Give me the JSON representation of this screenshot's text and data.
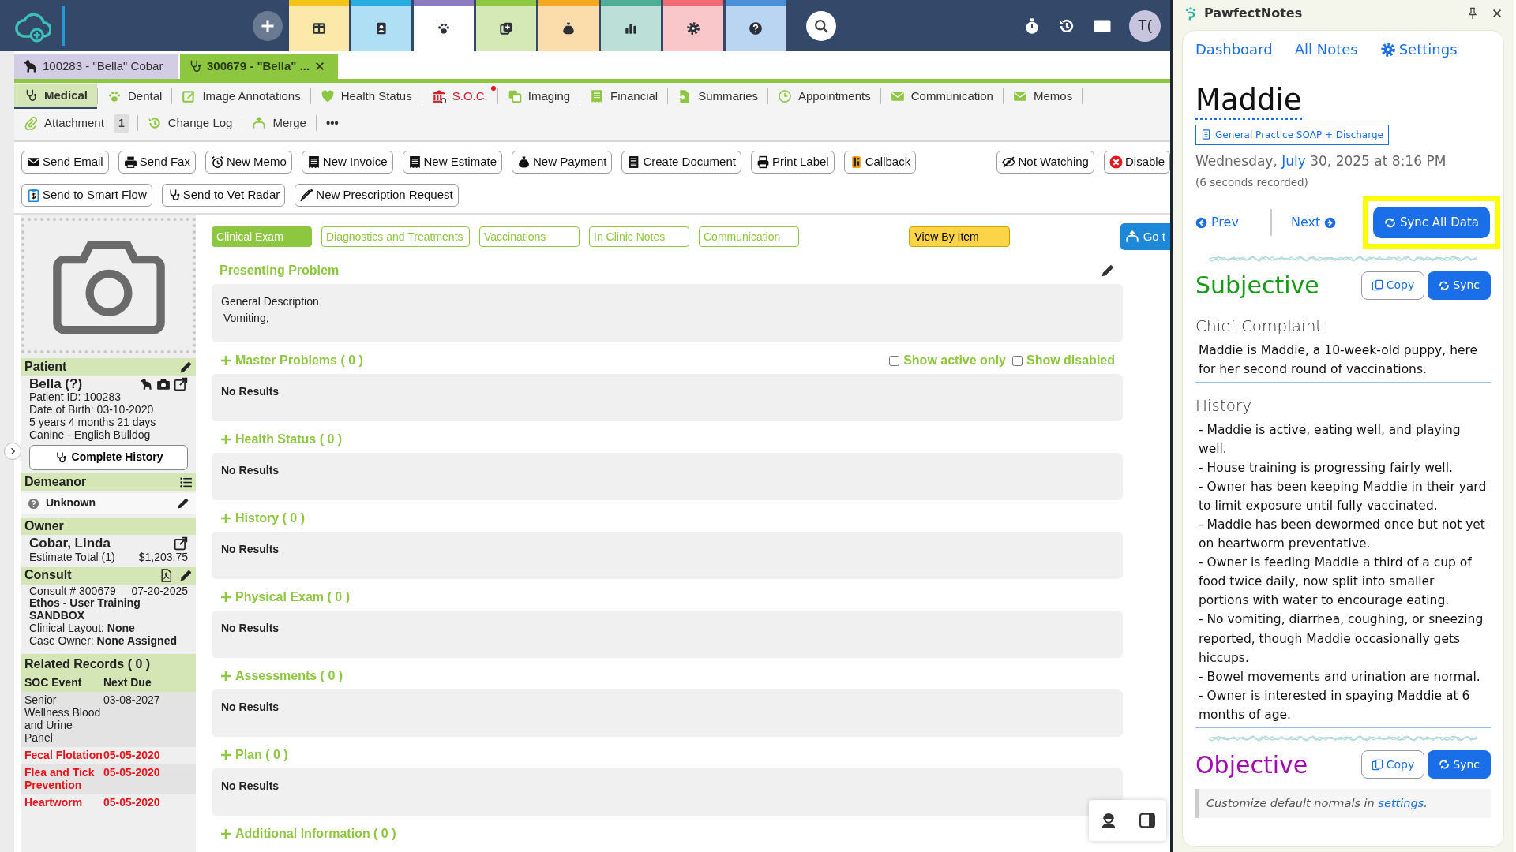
{
  "top_bar": {
    "modules": [
      {
        "color": "#f6c31c",
        "selected": false
      },
      {
        "color": "#29abe2",
        "selected": false
      },
      {
        "color": "#8e7cc3",
        "selected": true
      },
      {
        "color": "#8dc63f",
        "selected": false
      },
      {
        "color": "#f5a623",
        "selected": false
      },
      {
        "color": "#4fae96",
        "selected": false
      },
      {
        "color": "#ef6b73",
        "selected": false
      },
      {
        "color": "#4a90d9",
        "selected": false
      }
    ],
    "avatar": "T("
  },
  "record_tabs": [
    {
      "label": "100283 - \"Bella\" Cobar",
      "selected": false
    },
    {
      "label": "300679 - \"Bella\" ...",
      "selected": true
    }
  ],
  "nav_tabs": [
    {
      "label": "Medical",
      "selected": true,
      "alert": false
    },
    {
      "label": "Dental",
      "selected": false,
      "alert": false
    },
    {
      "label": "Image Annotations",
      "selected": false,
      "alert": false
    },
    {
      "label": "Health Status",
      "selected": false,
      "alert": false
    },
    {
      "label": "S.O.C.",
      "selected": false,
      "alert": true
    },
    {
      "label": "Imaging",
      "selected": false,
      "alert": false
    },
    {
      "label": "Financial",
      "selected": false,
      "alert": false
    },
    {
      "label": "Summaries",
      "selected": false,
      "alert": false
    },
    {
      "label": "Appointments",
      "selected": false,
      "alert": false
    },
    {
      "label": "Communication",
      "selected": false,
      "alert": false
    },
    {
      "label": "Memos",
      "selected": false,
      "alert": false
    }
  ],
  "nav_tools": [
    {
      "label": "Attachment",
      "count": "1"
    },
    {
      "label": "Change Log"
    },
    {
      "label": "Merge"
    }
  ],
  "more": "•••",
  "actions": [
    "Send Email",
    "Send Fax",
    "New Memo",
    "New Invoice",
    "New Estimate",
    "New Payment",
    "Create Document",
    "Print Label",
    "Callback"
  ],
  "actions_right": [
    "Not Watching",
    "Disable"
  ],
  "actions_row2": [
    "Send to Smart Flow",
    "Send to Vet Radar",
    "New Prescription Request"
  ],
  "sidebar": {
    "patient": {
      "title": "Patient",
      "name": "Bella (?)",
      "lines": [
        "Patient ID: 100283",
        "Date of Birth: 03-10-2020",
        "5 years 4 months 21 days",
        "Canine - English Bulldog"
      ],
      "button": "Complete History"
    },
    "demeanor": {
      "title": "Demeanor",
      "value": "Unknown"
    },
    "owner": {
      "title": "Owner",
      "name": "Cobar, Linda",
      "estimate_label": "Estimate Total (1)",
      "estimate_value": "$1,203.75"
    },
    "consult": {
      "title": "Consult",
      "number": "Consult # 300679",
      "date": "07-20-2025",
      "location": "Ethos - User Training SANDBOX",
      "fields": [
        "Clinical Layout: **None**",
        "Case Owner: **None Assigned**"
      ]
    },
    "related": {
      "title": "Related Records ( 0 )",
      "columns": [
        "SOC Event",
        "Next Due"
      ],
      "rows": [
        {
          "event": "Senior Wellness Blood and Urine Panel",
          "due": "03-08-2027",
          "overdue": false
        },
        {
          "event": "Fecal Flotation",
          "due": "05-05-2020",
          "overdue": true
        },
        {
          "event": "Flea and Tick Prevention",
          "due": "05-05-2020",
          "overdue": true
        },
        {
          "event": "Heartworm",
          "due": "05-05-2020",
          "overdue": true
        }
      ]
    }
  },
  "main": {
    "section_tabs": [
      {
        "label": "Clinical Exam",
        "selected": true
      },
      {
        "label": "Diagnostics and Treatments",
        "selected": false
      },
      {
        "label": "Vaccinations",
        "selected": false
      },
      {
        "label": "In Clinic Notes",
        "selected": false
      },
      {
        "label": "Communication",
        "selected": false
      }
    ],
    "view_button": "View By Item",
    "goto_button": "Go t",
    "presenting": {
      "title": "Presenting Problem",
      "lines": [
        "General Description",
        "Vomiting,"
      ]
    },
    "filters": [
      {
        "label": "Show active only",
        "checked": false
      },
      {
        "label": "Show disabled",
        "checked": false
      }
    ],
    "sections": [
      {
        "title": "Master Problems ( 0 )",
        "body": "No Results"
      },
      {
        "title": "Health Status ( 0 )",
        "body": "No Results"
      },
      {
        "title": "History ( 0 )",
        "body": "No Results"
      },
      {
        "title": "Physical Exam ( 0 )",
        "body": "No Results"
      },
      {
        "title": "Assessments ( 0 )",
        "body": "No Results"
      },
      {
        "title": "Plan ( 0 )",
        "body": "No Results"
      },
      {
        "title": "Additional Information ( 0 )"
      }
    ]
  },
  "panel": {
    "app_title": "PawfectNotes",
    "links": [
      "Dashboard",
      "All Notes",
      "Settings"
    ],
    "patient": "Maddie",
    "template": "General Practice SOAP + Discharge",
    "date_start": "Wednesday,",
    "date_month": "July",
    "date_end": "30, 2025 at 8:16 PM",
    "recorded": "(6 seconds recorded)",
    "prev": "Prev",
    "next": "Next",
    "sync_all": "Sync All Data",
    "highlighted": true,
    "sections": [
      {
        "title": "Subjective",
        "color": "#149b14",
        "copy": "Copy",
        "sync": "Sync",
        "fields": [
          {
            "label": "Chief Complaint",
            "lines": [
              "Maddie is Maddie, a 10-week-old puppy, here for her second round of vaccinations."
            ]
          },
          {
            "label": "History",
            "lines": [
              "- Maddie is active, eating well, and playing well.",
              "- House training is progressing fairly well.",
              "- Owner has been keeping Maddie in their yard to limit exposure until fully vaccinated.",
              "- Maddie has been dewormed once but not yet on heartworm preventative.",
              "- Owner is feeding Maddie a third of a cup of food twice daily, now split into smaller portions with water to encourage eating.",
              "- No vomiting, diarrhea, coughing, or sneezing reported, though Maddie occasionally gets hiccups.",
              "- Bowel movements and urination are normal.",
              "- Owner is interested in spaying Maddie at 6 months of age."
            ]
          }
        ]
      },
      {
        "title": "Objective",
        "color": "#a20ab0",
        "copy": "Copy",
        "sync": "Sync",
        "note_start": "Customize default normals in",
        "note_link": "settings",
        "note_end": "."
      }
    ]
  }
}
